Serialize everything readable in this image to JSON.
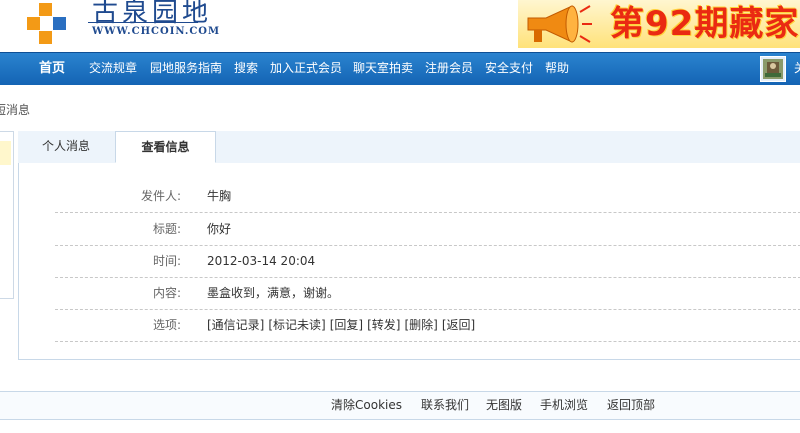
{
  "header": {
    "logo_title": "古泉园地",
    "logo_url": "WWW.CHCOIN.COM",
    "banner_text": "第92期藏家",
    "colors": {
      "logo_orange": "#f39a16",
      "logo_blue": "#2a6fc1",
      "banner_red": "#ea2a12"
    }
  },
  "nav": {
    "home": "首页",
    "items": [
      "交流规章",
      "园地服务指南",
      "搜索",
      "加入正式会员",
      "聊天室拍卖",
      "注册会员",
      "安全支付",
      "帮助"
    ],
    "right_text": "关",
    "color": "#1a6fbf"
  },
  "breadcrumb": "短消息",
  "tabs": [
    "个人消息",
    "查看信息"
  ],
  "message": {
    "sender_label": "发件人:",
    "sender": "牛胸",
    "subject_label": "标题:",
    "subject": "你好",
    "time_label": "时间:",
    "time": "2012-03-14 20:04",
    "content_label": "内容:",
    "content": "墨盒收到，满意，谢谢。",
    "options_label": "选项:",
    "options": [
      "[通信记录]",
      "[标记未读]",
      "[回复]",
      "[转发]",
      "[删除]",
      "[返回]"
    ]
  },
  "footer": {
    "links": [
      "清除Cookies",
      "联系我们",
      "无图版",
      "手机浏览",
      "返回顶部"
    ]
  }
}
